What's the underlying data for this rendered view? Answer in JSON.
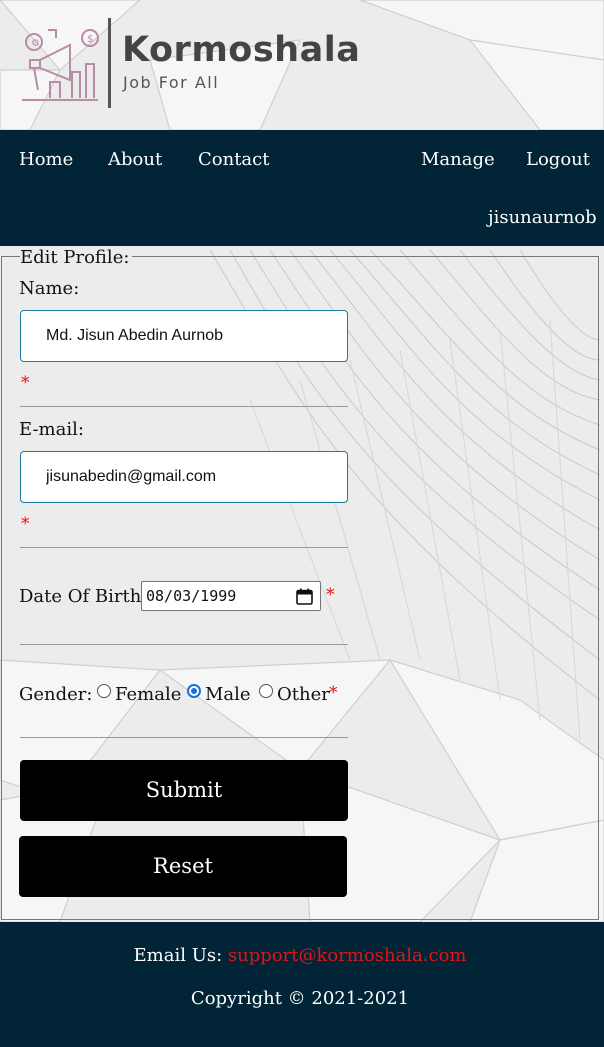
{
  "brand": {
    "title": "Kormoshala",
    "tagline": "Job For All"
  },
  "nav": {
    "home": "Home",
    "about": "About",
    "contact": "Contact",
    "manage": "Manage",
    "logout": "Logout",
    "username": "jisunaurnob"
  },
  "form": {
    "legend": "Edit Profile:",
    "name_label": "Name:",
    "name_value": "Md. Jisun Abedin Aurnob",
    "email_label": "E-mail:",
    "email_value": "jisunabedin@gmail.com",
    "dob_label": "Date Of Birth:",
    "dob_value": "08/03/1999",
    "gender_label": "Gender:",
    "gender_options": [
      "Female",
      "Male",
      "Other"
    ],
    "gender_selected": "Male",
    "required_mark": "*",
    "submit_label": "Submit",
    "reset_label": "Reset"
  },
  "footer": {
    "email_prefix": "Email Us: ",
    "email": "support@kormoshala.com",
    "copyright": "Copyright © 2021-2021"
  },
  "colors": {
    "nav_bg": "#022437",
    "required": "#e31414",
    "button_bg": "#000000",
    "radio_accent": "#1673d9"
  }
}
